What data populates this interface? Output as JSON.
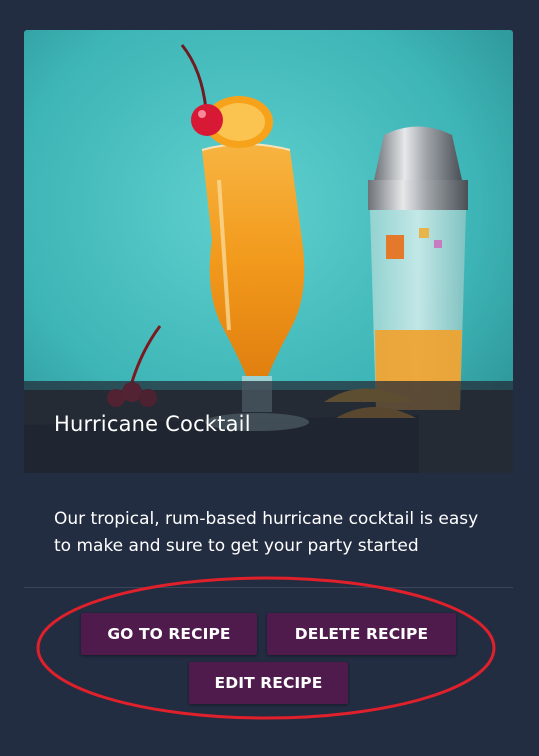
{
  "card": {
    "title": "Hurricane Cocktail",
    "description": "Our tropical, rum-based hurricane cocktail is easy to make and sure to get your party started"
  },
  "actions": {
    "go_to_recipe": "GO TO RECIPE",
    "delete_recipe": "DELETE RECIPE",
    "edit_recipe": "EDIT RECIPE"
  },
  "colors": {
    "page_background": "#232d42",
    "button_background": "#4e1b4c",
    "annotation_ellipse": "#e0202a"
  }
}
